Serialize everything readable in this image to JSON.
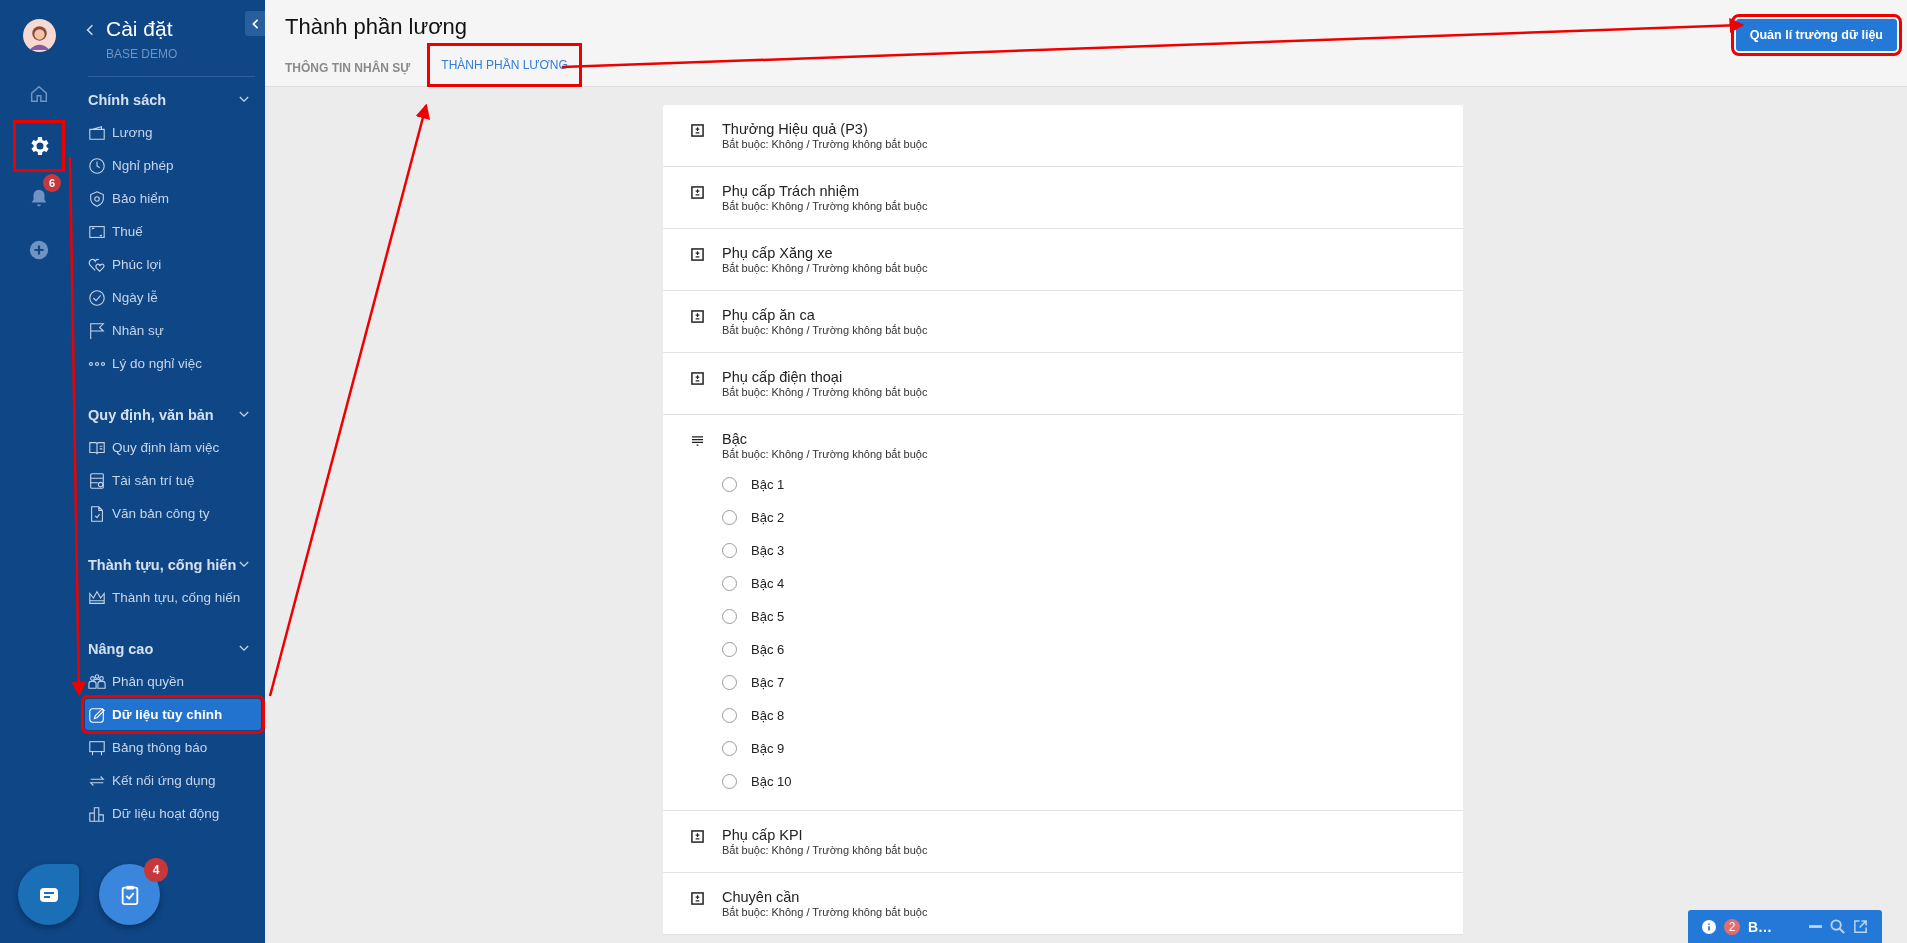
{
  "rail": {
    "items": [
      {
        "kind": "home",
        "selected": false
      },
      {
        "kind": "settings",
        "selected": true,
        "highlighted": true
      },
      {
        "kind": "bell",
        "selected": false,
        "badge": "6"
      },
      {
        "kind": "add",
        "selected": false
      }
    ]
  },
  "sidebar": {
    "title": "Cài đặt",
    "subtitle": "BASE DEMO",
    "sections": [
      {
        "heading": "Chính sách",
        "expanded": true,
        "items": [
          {
            "kind": "wallet",
            "label": "Lương",
            "selected": false
          },
          {
            "kind": "clock",
            "label": "Nghỉ phép",
            "selected": false
          },
          {
            "kind": "shield",
            "label": "Bảo hiểm",
            "selected": false
          },
          {
            "kind": "frame",
            "label": "Thuế",
            "selected": false
          },
          {
            "kind": "hearts",
            "label": "Phúc lợi",
            "selected": false
          },
          {
            "kind": "check",
            "label": "Ngày lễ",
            "selected": false
          },
          {
            "kind": "flag",
            "label": "Nhân sự",
            "selected": false
          },
          {
            "kind": "dots",
            "label": "Lý do nghỉ việc",
            "selected": false
          }
        ]
      },
      {
        "heading": "Quy định, văn bản",
        "expanded": true,
        "items": [
          {
            "kind": "book",
            "label": "Quy định làm việc",
            "selected": false
          },
          {
            "kind": "asset",
            "label": "Tài sản trí tuệ",
            "selected": false
          },
          {
            "kind": "document",
            "label": "Văn bản công ty",
            "selected": false
          }
        ]
      },
      {
        "heading": "Thành tựu, cống hiến",
        "expanded": true,
        "items": [
          {
            "kind": "crown",
            "label": "Thành tựu, cống hiến",
            "selected": false
          }
        ]
      },
      {
        "heading": "Nâng cao",
        "expanded": true,
        "items": [
          {
            "kind": "people",
            "label": "Phân quyền",
            "selected": false
          },
          {
            "kind": "edit",
            "label": "Dữ liệu tùy chỉnh",
            "selected": true,
            "highlighted": true
          },
          {
            "kind": "board",
            "label": "Bảng thông báo",
            "selected": false
          },
          {
            "kind": "arrows",
            "label": "Kết nối ứng dụng",
            "selected": false
          },
          {
            "kind": "bars",
            "label": "Dữ liệu hoạt động",
            "selected": false
          }
        ]
      }
    ]
  },
  "floating_buttons": [
    {
      "kind": "chat"
    },
    {
      "kind": "tasks",
      "badge": "4"
    }
  ],
  "header": {
    "title": "Thành phần lương",
    "tabs": [
      {
        "label": "THÔNG TIN NHÂN SỰ",
        "selected": false
      },
      {
        "label": "THÀNH PHẦN LƯƠNG",
        "selected": true,
        "highlighted": true
      }
    ],
    "action_button": {
      "label": "Quản lí trường dữ liệu",
      "highlighted": true
    }
  },
  "fields": [
    {
      "kind": "number",
      "title": "Thưởng Hiệu quả (P3)",
      "subtitle": "Bắt buộc: Không / Trường không bắt buộc"
    },
    {
      "kind": "number",
      "title": "Phụ cấp Trách nhiệm",
      "subtitle": "Bắt buộc: Không / Trường không bắt buộc"
    },
    {
      "kind": "number",
      "title": "Phụ cấp Xăng xe",
      "subtitle": "Bắt buộc: Không / Trường không bắt buộc"
    },
    {
      "kind": "number",
      "title": "Phụ cấp ăn ca",
      "subtitle": "Bắt buộc: Không / Trường không bắt buộc"
    },
    {
      "kind": "number",
      "title": "Phụ cấp điện thoại",
      "subtitle": "Bắt buộc: Không / Trường không bắt buộc"
    },
    {
      "kind": "select",
      "title": "Bậc",
      "subtitle": "Bắt buộc: Không / Trường không bắt buộc",
      "options": [
        {
          "label": "Bậc 1",
          "selected": false
        },
        {
          "label": "Bậc 2",
          "selected": false
        },
        {
          "label": "Bậc 3",
          "selected": false
        },
        {
          "label": "Bậc 4",
          "selected": false
        },
        {
          "label": "Bậc 5",
          "selected": false
        },
        {
          "label": "Bậc 6",
          "selected": false
        },
        {
          "label": "Bậc 7",
          "selected": false
        },
        {
          "label": "Bậc 8",
          "selected": false
        },
        {
          "label": "Bậc 9",
          "selected": false
        },
        {
          "label": "Bậc 10",
          "selected": false
        }
      ]
    },
    {
      "kind": "number",
      "title": "Phụ cấp KPI",
      "subtitle": "Bắt buộc: Không / Trường không bắt buộc"
    },
    {
      "kind": "number",
      "title": "Chuyên cần",
      "subtitle": "Bắt buộc: Không / Trường không bắt buộc"
    }
  ],
  "chat_widget": {
    "badge": "2",
    "title": "B…"
  }
}
